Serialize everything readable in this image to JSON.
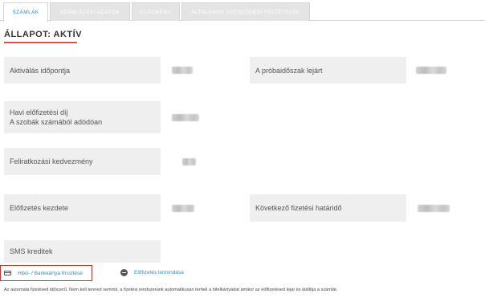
{
  "tabs": [
    {
      "label": "SZÁMLÁK",
      "active": true
    },
    {
      "label": "SZÁMLÁZÁSI ADATOK",
      "active": false
    },
    {
      "label": "ELŐZMÉNY",
      "active": false
    },
    {
      "label": "ÁLTALÁNOS SZERZŐDÉSI FELTÉTELEK",
      "active": false
    }
  ],
  "status": {
    "title": "ÁLLAPOT: AKTÍV"
  },
  "fields": {
    "activation": {
      "label": "Aktiválás időpontja"
    },
    "trial_end": {
      "label": "A próbaidőszak lejárt"
    },
    "monthly_fee": {
      "label_line1": "Havi előfizetési díj",
      "label_line2": "A szobák számából adódóan"
    },
    "signup_discount": {
      "label": "Feliratkozási kedvezmény"
    },
    "subscription_start": {
      "label": "Előfizetés kezdete"
    },
    "next_payment": {
      "label": "Következő fizetési határidő"
    },
    "sms_credits": {
      "label": "SMS kreditek"
    }
  },
  "actions": {
    "update_card": "Hitel- / Bankkártya frissítése",
    "cancel_subscription": "Előfizetés lemondása"
  },
  "footnote": "Az automata fizetésed időszerű. Nem kell tenned semmit, a fizetési rendszerünk automatikusan terheli a hitelkártyádat amikor az előfizetésed lejár és kiállítja a számlát.",
  "colors": {
    "accent": "#2f8fc3",
    "highlight_border": "#c9302c",
    "underline": "#d9534f",
    "field_bg": "#efefef"
  }
}
